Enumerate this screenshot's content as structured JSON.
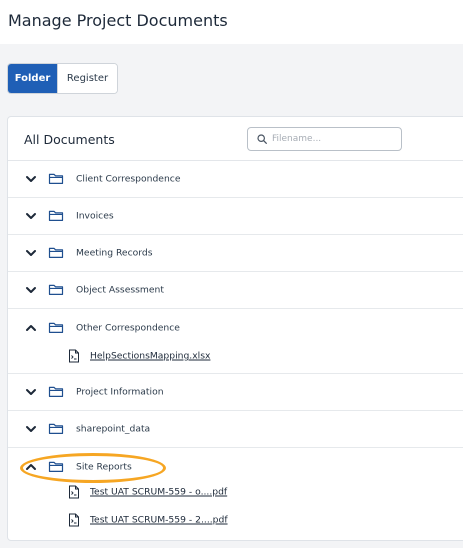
{
  "header": {
    "title": "Manage Project Documents"
  },
  "view_toggle": {
    "folder_label": "Folder",
    "register_label": "Register"
  },
  "panel": {
    "heading": "All Documents",
    "search_placeholder": "Filename...",
    "folders": [
      {
        "label": "Client Correspondence",
        "expanded": false
      },
      {
        "label": "Invoices",
        "expanded": false
      },
      {
        "label": "Meeting Records",
        "expanded": false
      },
      {
        "label": "Object Assessment",
        "expanded": false
      },
      {
        "label": "Other Correspondence",
        "expanded": true,
        "files": [
          "HelpSectionsMapping.xlsx"
        ]
      },
      {
        "label": "Project Information",
        "expanded": false
      },
      {
        "label": "sharepoint_data",
        "expanded": false
      },
      {
        "label": "Site Reports",
        "expanded": true,
        "files": [
          "Test UAT SCRUM-559 - o....pdf",
          "Test UAT SCRUM-559 - 2....pdf"
        ]
      }
    ]
  },
  "colors": {
    "accent": "#1f5fb6",
    "highlight": "#f6a623",
    "folder_icon": "#1f4f8f"
  }
}
